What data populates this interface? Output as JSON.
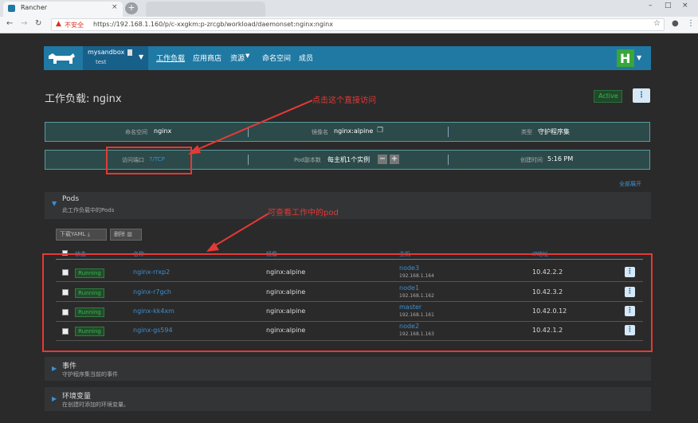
{
  "browser": {
    "tab_title": "Rancher",
    "tab2_title": "",
    "insecure_label": "不安全",
    "url": "https://192.168.1.160/p/c-xxgkm:p-zrcgb/workload/daemonset:nginx:nginx"
  },
  "header": {
    "project_name": "mysandbox",
    "project_sub": "test",
    "nav": [
      "工作负载",
      "应用商店",
      "资源",
      "命名空间",
      "成员"
    ]
  },
  "page": {
    "title": "工作负载: nginx",
    "status": "Active",
    "annotation1": "点击这个直接访问",
    "annotation2": "可查看工作中的pod",
    "collapse_all": "全部展开"
  },
  "info": {
    "namespace_label": "命名空间",
    "namespace_value": "nginx",
    "image_label": "镜像名",
    "image_value": "nginx:alpine",
    "type_label": "类型",
    "type_value": "守护程序集",
    "port_label": "访问端口",
    "port_value": "7/TCP",
    "pods_label": "Pod副本数",
    "pods_value": "每主机1个实例",
    "created_label": "创建时间",
    "created_value": "5:16 PM"
  },
  "pods_section": {
    "title": "Pods",
    "subtitle": "此工作负载中的Pods",
    "download_yaml": "下载YAML",
    "delete": "删除",
    "columns": [
      "状态",
      "名称",
      "镜像",
      "主机",
      "IP地址"
    ],
    "rows": [
      {
        "status": "Running",
        "name": "nginx-rrxp2",
        "image": "nginx:alpine",
        "host": "node3",
        "host_ip": "192.168.1.164",
        "ip": "10.42.2.2"
      },
      {
        "status": "Running",
        "name": "nginx-r7gch",
        "image": "nginx:alpine",
        "host": "node1",
        "host_ip": "192.168.1.162",
        "ip": "10.42.3.2"
      },
      {
        "status": "Running",
        "name": "nginx-kk4xm",
        "image": "nginx:alpine",
        "host": "master",
        "host_ip": "192.168.1.161",
        "ip": "10.42.0.12"
      },
      {
        "status": "Running",
        "name": "nginx-gs594",
        "image": "nginx:alpine",
        "host": "node2",
        "host_ip": "192.168.1.163",
        "ip": "10.42.1.2"
      }
    ]
  },
  "events_section": {
    "title": "事件",
    "subtitle": "守护程序集当前的事件"
  },
  "env_section": {
    "title": "环境变量",
    "subtitle": "在创建时添加的环境变量。"
  },
  "colors": {
    "accent": "#1f79a3",
    "running": "#3bb34e",
    "annotation": "#e53935",
    "link": "#3d8fd1"
  }
}
